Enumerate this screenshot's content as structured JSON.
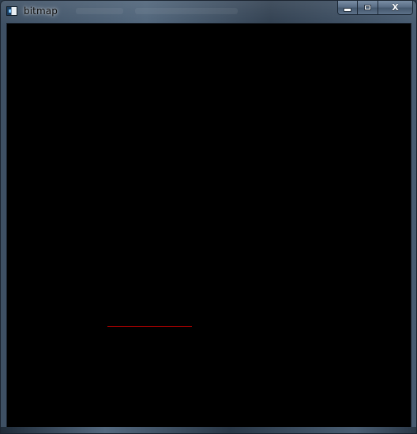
{
  "window": {
    "title": "bitmap",
    "icon": "app-window-icon",
    "controls": {
      "minimize": "minimize-icon",
      "maximize": "maximize-icon",
      "close": "close-icon"
    }
  },
  "canvas": {
    "background": "#000000",
    "line_color": "#cc0000"
  }
}
